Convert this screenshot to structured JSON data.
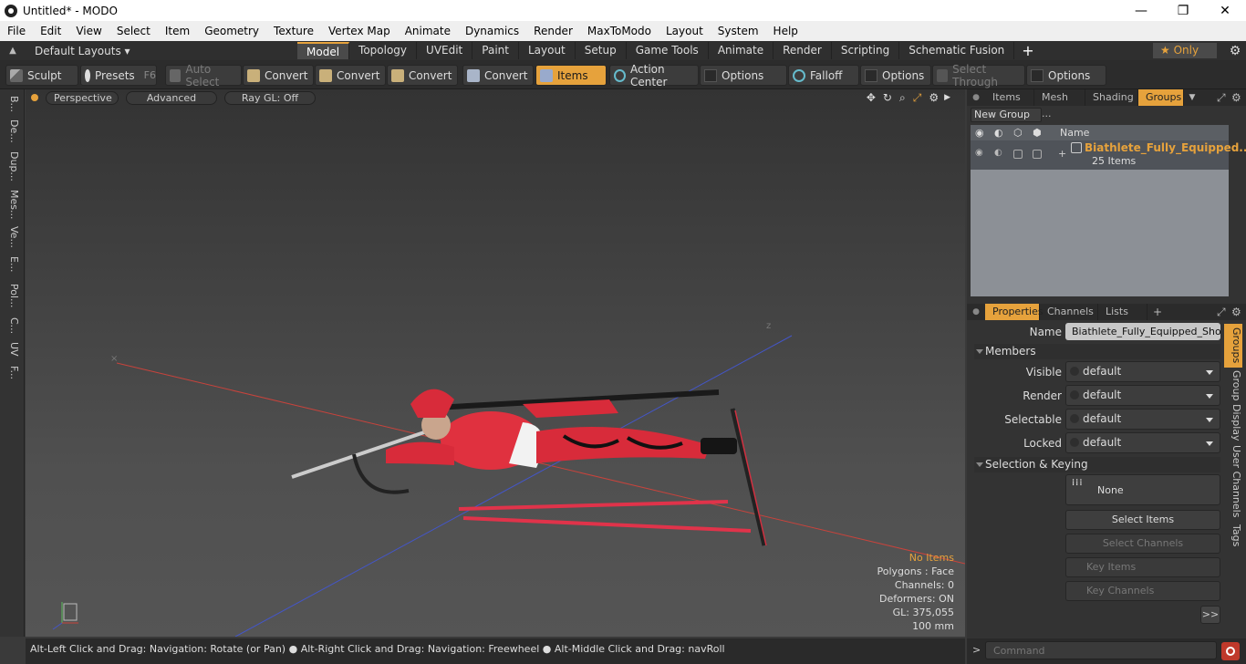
{
  "window": {
    "title": "Untitled* - MODO",
    "minimize": "—",
    "maximize": "❐",
    "close": "✕"
  },
  "menu": [
    "File",
    "Edit",
    "View",
    "Select",
    "Item",
    "Geometry",
    "Texture",
    "Vertex Map",
    "Animate",
    "Dynamics",
    "Render",
    "MaxToModo",
    "Layout",
    "System",
    "Help"
  ],
  "layout": {
    "default_layouts": "Default Layouts ▾",
    "tabs": [
      "Model",
      "Topology",
      "UVEdit",
      "Paint",
      "Layout",
      "Setup",
      "Game Tools",
      "Animate",
      "Render",
      "Scripting",
      "Schematic Fusion"
    ],
    "add": "+",
    "only": "★  Only"
  },
  "toolbar": {
    "sculpt": "Sculpt",
    "presets": "Presets",
    "presets_key": "F6",
    "auto_select": "Auto Select",
    "convert": "Convert",
    "items": "Items",
    "action_center": "Action Center",
    "options": "Options",
    "falloff": "Falloff",
    "select_through": "Select Through"
  },
  "left_tabs": [
    "B...",
    "De...",
    "Dup...",
    "Mes...",
    "Ve...",
    "E...",
    "Pol...",
    "C...",
    "UV",
    "F..."
  ],
  "viewport": {
    "perspective": "Perspective",
    "advanced": "Advanced",
    "raygl": "Ray GL: Off",
    "hud": {
      "no_items": "No Items",
      "polygons": "Polygons : Face",
      "channels": "Channels: 0",
      "deformers": "Deformers: ON",
      "gl": "GL: 375,055",
      "scale": "100 mm"
    },
    "colors": {
      "no_items": "#e6a23c",
      "x_axis": "#c8433c",
      "z_axis": "#4456c8"
    }
  },
  "status": "Alt-Left Click and Drag: Navigation: Rotate (or Pan) ● Alt-Right Click and Drag: Navigation: Freewheel ● Alt-Middle Click and Drag: navRoll",
  "panel_top": {
    "tabs": [
      "Items",
      "Mesh ...",
      "Shading",
      "Groups"
    ],
    "new_group": "New Group",
    "col_name": "Name",
    "group_name": "Biathlete_Fully_Equipped...",
    "group_count": "25 Items"
  },
  "panel_props": {
    "tabs": [
      "Properties",
      "Channels",
      "Lists"
    ],
    "add": "+",
    "name_label": "Name",
    "name_value": "Biathlete_Fully_Equipped_Shooti",
    "members": "Members",
    "visible_label": "Visible",
    "render_label": "Render",
    "selectable_label": "Selectable",
    "locked_label": "Locked",
    "default": "default",
    "sel_keying": "Selection & Keying",
    "none": "None",
    "select_items": "Select Items",
    "select_channels": "Select Channels",
    "key_items": "Key Items",
    "key_channels": "Key Channels",
    "more": ">>",
    "side_tabs": [
      "Groups",
      "Group Display",
      "User Channels",
      "Tags"
    ]
  },
  "command": {
    "placeholder": "Command",
    "prompt": ">"
  }
}
